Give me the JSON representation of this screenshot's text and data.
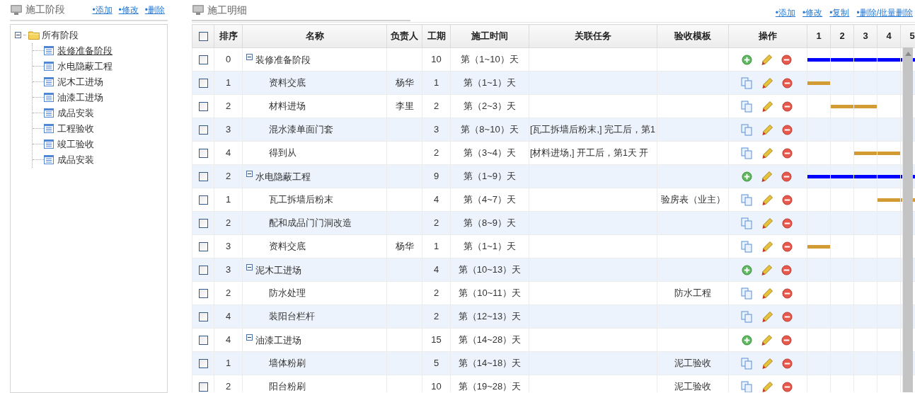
{
  "left_panel": {
    "title": "施工阶段",
    "actions": [
      "•添加",
      "•修改",
      "•删除"
    ],
    "tree": [
      {
        "label": "所有阶段",
        "expanded": true,
        "children": [
          {
            "label": "装修准备阶段",
            "selected": true
          },
          {
            "label": "水电隐蔽工程",
            "selected": false
          },
          {
            "label": "泥木工进场",
            "selected": false
          },
          {
            "label": "油漆工进场",
            "selected": false
          },
          {
            "label": "成品安装",
            "selected": false
          },
          {
            "label": "工程验收",
            "selected": false
          },
          {
            "label": "竣工验收",
            "selected": false
          },
          {
            "label": "成品安装",
            "selected": false
          }
        ]
      }
    ]
  },
  "right_panel": {
    "title": "施工明细",
    "actions": [
      "•添加",
      "•修改",
      "•复制",
      "•删除/批量删除"
    ],
    "table": {
      "select_all_checked": false,
      "columns": [
        "排序",
        "名称",
        "负责人",
        "工期",
        "施工时间",
        "关联任务",
        "验收模板",
        "操作"
      ],
      "gantt_days": [
        "1",
        "2",
        "3",
        "4",
        "5"
      ],
      "rows": [
        {
          "kind": "group",
          "checked": false,
          "expanded": true,
          "order": "0",
          "name": "装修准备阶段",
          "duration": "10",
          "time": "第（1~10）天",
          "gantt": [
            true,
            true,
            true,
            true,
            true
          ]
        },
        {
          "kind": "task",
          "checked": false,
          "order": "1",
          "name": "资料交底",
          "owner": "杨华",
          "duration": "1",
          "time": "第（1~1）天",
          "gantt": [
            true,
            false,
            false,
            false,
            false
          ]
        },
        {
          "kind": "task",
          "checked": false,
          "order": "2",
          "name": "材料进场",
          "owner": "李里",
          "duration": "2",
          "time": "第（2~3）天",
          "gantt": [
            false,
            true,
            true,
            false,
            false
          ]
        },
        {
          "kind": "task",
          "checked": false,
          "order": "3",
          "name": "混水漆单面门套",
          "duration": "3",
          "time": "第（8~10）天",
          "related": "[瓦工拆墙后粉末,] 完工后，第1",
          "gantt": [
            false,
            false,
            false,
            false,
            false
          ]
        },
        {
          "kind": "task",
          "checked": false,
          "order": "4",
          "name": "得到从",
          "duration": "2",
          "time": "第（3~4）天",
          "related": "[材料进场,] 开工后，第1天 开",
          "gantt": [
            false,
            false,
            true,
            true,
            false
          ]
        },
        {
          "kind": "group",
          "checked": false,
          "expanded": true,
          "order": "2",
          "name": "水电隐蔽工程",
          "duration": "9",
          "time": "第（1~9）天",
          "gantt": [
            true,
            true,
            true,
            true,
            true
          ]
        },
        {
          "kind": "task",
          "checked": false,
          "order": "1",
          "name": "瓦工拆墙后粉末",
          "duration": "4",
          "time": "第（4~7）天",
          "template": "验房表（业主）",
          "gantt": [
            false,
            false,
            false,
            true,
            true
          ]
        },
        {
          "kind": "task",
          "checked": false,
          "order": "2",
          "name": "配和成品门门洞改造",
          "duration": "2",
          "time": "第（8~9）天",
          "gantt": [
            false,
            false,
            false,
            false,
            false
          ]
        },
        {
          "kind": "task",
          "checked": false,
          "order": "3",
          "name": "资料交底",
          "owner": "杨华",
          "duration": "1",
          "time": "第（1~1）天",
          "gantt": [
            true,
            false,
            false,
            false,
            false
          ]
        },
        {
          "kind": "group",
          "checked": false,
          "expanded": true,
          "order": "3",
          "name": "泥木工进场",
          "duration": "4",
          "time": "第（10~13）天",
          "gantt": [
            false,
            false,
            false,
            false,
            false
          ]
        },
        {
          "kind": "task",
          "checked": false,
          "order": "2",
          "name": "防水处理",
          "duration": "2",
          "time": "第（10~11）天",
          "template": "防水工程",
          "gantt": [
            false,
            false,
            false,
            false,
            false
          ]
        },
        {
          "kind": "task",
          "checked": false,
          "order": "4",
          "name": "装阳台栏杆",
          "duration": "2",
          "time": "第（12~13）天",
          "gantt": [
            false,
            false,
            false,
            false,
            false
          ]
        },
        {
          "kind": "group",
          "checked": false,
          "expanded": true,
          "order": "4",
          "name": "油漆工进场",
          "duration": "15",
          "time": "第（14~28）天",
          "gantt": [
            false,
            false,
            false,
            false,
            false
          ]
        },
        {
          "kind": "task",
          "checked": false,
          "order": "1",
          "name": "墙体粉刷",
          "duration": "5",
          "time": "第（14~18）天",
          "template": "泥工验收",
          "gantt": [
            false,
            false,
            false,
            false,
            false
          ]
        },
        {
          "kind": "task",
          "checked": false,
          "order": "2",
          "name": "阳台粉刷",
          "duration": "10",
          "time": "第（19~28）天",
          "template": "泥工验收",
          "gantt": [
            false,
            false,
            false,
            false,
            false
          ]
        }
      ]
    }
  }
}
